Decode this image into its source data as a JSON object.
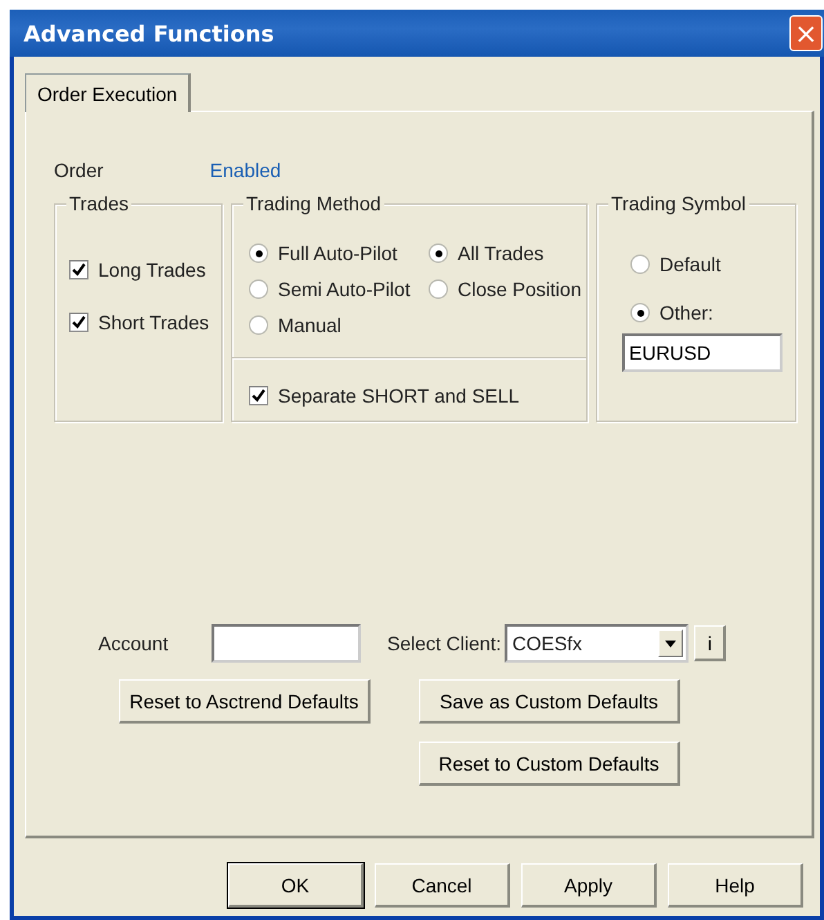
{
  "window": {
    "title": "Advanced Functions",
    "close": "×"
  },
  "tabs": [
    {
      "label": "Order Execution",
      "selected": true
    }
  ],
  "order": {
    "label": "Order",
    "status": "Enabled"
  },
  "trades": {
    "title": "Trades",
    "items": [
      {
        "label": "Long Trades",
        "checked": true
      },
      {
        "label": "Short Trades",
        "checked": true
      }
    ]
  },
  "trading_method": {
    "title": "Trading Method",
    "modes": [
      {
        "label": "Full Auto-Pilot",
        "selected": true
      },
      {
        "label": "Semi Auto-Pilot",
        "selected": false
      },
      {
        "label": "Manual",
        "selected": false
      }
    ],
    "scope": [
      {
        "label": "All Trades",
        "selected": true
      },
      {
        "label": "Close Position",
        "selected": false
      }
    ],
    "separate": {
      "label": "Separate SHORT and SELL",
      "checked": true
    }
  },
  "trading_symbol": {
    "title": "Trading Symbol",
    "options": [
      {
        "label": "Default",
        "selected": false
      },
      {
        "label": "Other:",
        "selected": true
      }
    ],
    "value": "EURUSD"
  },
  "account": {
    "label": "Account"
  },
  "client": {
    "label": "Select Client:",
    "value": "COESfx",
    "info": "i"
  },
  "panel_buttons": [
    "Reset to Asctrend Defaults",
    "Save as Custom Defaults",
    "Reset to Custom Defaults"
  ],
  "buttons": [
    {
      "label": "OK",
      "default": true
    },
    {
      "label": "Cancel",
      "default": false
    },
    {
      "label": "Apply",
      "default": false
    },
    {
      "label": "Help",
      "default": false
    }
  ]
}
